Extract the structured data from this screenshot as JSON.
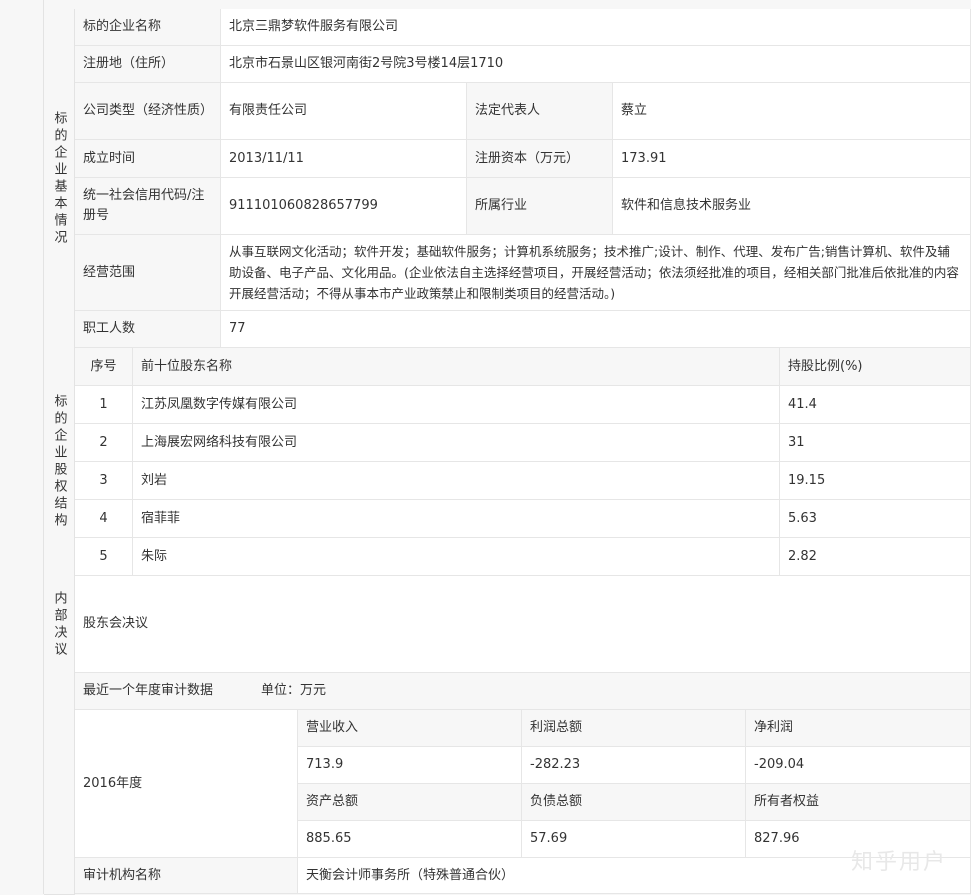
{
  "sections": {
    "basic": "标的企业基本情况",
    "shareholding": "标的企业股权结构",
    "internal_decision": "内部决议"
  },
  "basic_info": {
    "name_label": "标的企业名称",
    "name_value": "北京三鼎梦软件服务有限公司",
    "address_label": "注册地（住所）",
    "address_value": "北京市石景山区银河南街2号院3号楼14层1710",
    "company_type_label": "公司类型（经济性质）",
    "company_type_value": "有限责任公司",
    "legal_rep_label": "法定代表人",
    "legal_rep_value": "蔡立",
    "founded_label": "成立时间",
    "founded_value": "2013/11/11",
    "reg_capital_label": "注册资本（万元）",
    "reg_capital_value": "173.91",
    "credit_code_label": "统一社会信用代码/注册号",
    "credit_code_value": "911101060828657799",
    "industry_label": "所属行业",
    "industry_value": "软件和信息技术服务业",
    "scope_label": "经营范围",
    "scope_value": "从事互联网文化活动；软件开发；基础软件服务；计算机系统服务；技术推广;设计、制作、代理、发布广告;销售计算机、软件及辅助设备、电子产品、文化用品。(企业依法自主选择经营项目，开展经营活动；依法须经批准的项目，经相关部门批准后依批准的内容开展经营活动；不得从事本市产业政策禁止和限制类项目的经营活动。)",
    "employees_label": "职工人数",
    "employees_value": "77"
  },
  "shareholders": {
    "col_no": "序号",
    "col_name": "前十位股东名称",
    "col_ratio": "持股比例(%)",
    "rows": [
      {
        "no": "1",
        "name": "江苏凤凰数字传媒有限公司",
        "ratio": "41.4"
      },
      {
        "no": "2",
        "name": "上海展宏网络科技有限公司",
        "ratio": "31"
      },
      {
        "no": "3",
        "name": "刘岩",
        "ratio": "19.15"
      },
      {
        "no": "4",
        "name": "宿菲菲",
        "ratio": "5.63"
      },
      {
        "no": "5",
        "name": "朱际",
        "ratio": "2.82"
      }
    ]
  },
  "internal_decision_value": "股东会决议",
  "audit": {
    "title": "最近一个年度审计数据",
    "unit": "单位：万元",
    "year": "2016年度",
    "revenue_label": "营业收入",
    "revenue_value": "713.9",
    "total_profit_label": "利润总额",
    "total_profit_value": "-282.23",
    "net_profit_label": "净利润",
    "net_profit_value": "-209.04",
    "total_assets_label": "资产总额",
    "total_assets_value": "885.65",
    "total_liabilities_label": "负债总额",
    "total_liabilities_value": "57.69",
    "equity_label": "所有者权益",
    "equity_value": "827.96",
    "auditor_label": "审计机构名称",
    "auditor_value": "天衡会计师事务所（特殊普通合伙）"
  },
  "watermark": "知乎用户"
}
